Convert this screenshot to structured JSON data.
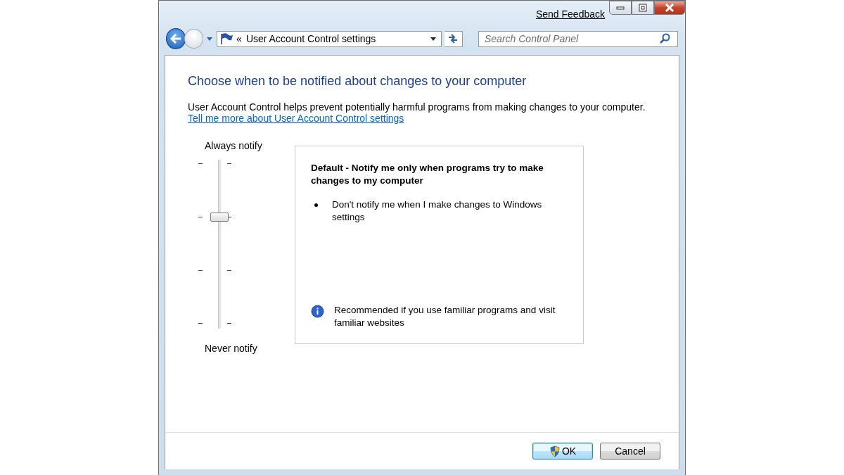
{
  "window": {
    "send_feedback": "Send Feedback"
  },
  "nav": {
    "chevron": "«",
    "address": "User Account Control settings",
    "search": {
      "placeholder": "Search Control Panel"
    }
  },
  "heading": "Choose when to be notified about changes to your computer",
  "description": "User Account Control helps prevent potentially harmful programs from making changes to your computer.",
  "help_link": "Tell me more about User Account Control settings",
  "slider": {
    "top_label": "Always notify",
    "bottom_label": "Never notify",
    "level": 0.667
  },
  "info_panel": {
    "title": "Default - Notify me only when programs try to make changes to my computer",
    "bullets": [
      "Don't notify me when I make changes to Windows settings"
    ],
    "note": "Recommended if you use familiar programs and visit familiar websites"
  },
  "buttons": [
    {
      "label": "OK",
      "kind": "shield",
      "default": true
    },
    {
      "label": "Cancel",
      "kind": "plain",
      "default": false
    }
  ]
}
